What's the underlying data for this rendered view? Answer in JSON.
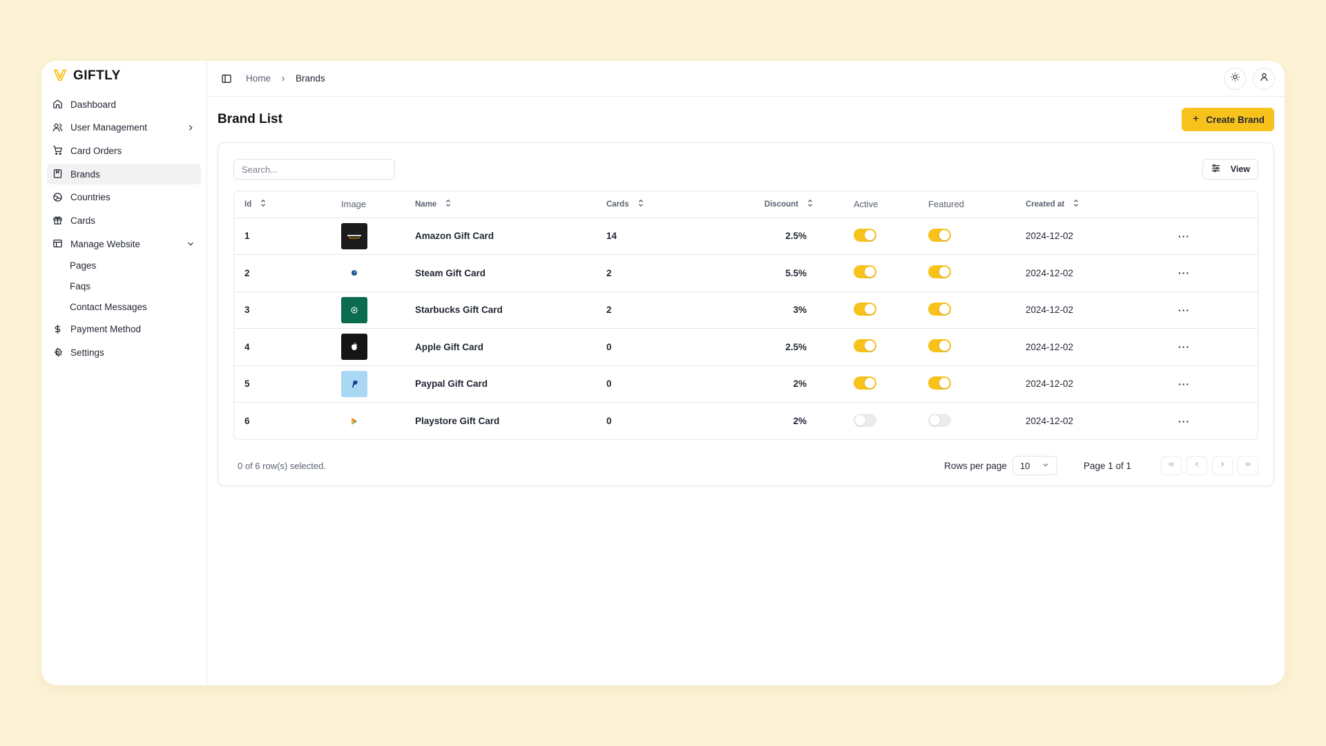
{
  "app": {
    "name": "GIFTLY",
    "accent": "#f8c21c",
    "background": "#fdf3d6"
  },
  "sidebar": {
    "items": [
      {
        "label": "Dashboard",
        "icon": "home-icon"
      },
      {
        "label": "User Management",
        "icon": "users-icon",
        "expandable": true,
        "expanded": false
      },
      {
        "label": "Card Orders",
        "icon": "cart-icon"
      },
      {
        "label": "Brands",
        "icon": "bookmark-icon",
        "active": true
      },
      {
        "label": "Countries",
        "icon": "globe-icon"
      },
      {
        "label": "Cards",
        "icon": "gift-icon"
      },
      {
        "label": "Manage Website",
        "icon": "layout-icon",
        "expandable": true,
        "expanded": true,
        "children": [
          "Pages",
          "Faqs",
          "Contact Messages"
        ]
      },
      {
        "label": "Payment Method",
        "icon": "dollar-icon"
      },
      {
        "label": "Settings",
        "icon": "settings-icon"
      }
    ]
  },
  "topbar": {
    "breadcrumb": {
      "home": "Home",
      "current": "Brands"
    },
    "icons": [
      "sun-icon",
      "user-icon"
    ]
  },
  "page": {
    "title": "Brand List",
    "create_label": "Create Brand"
  },
  "toolbar": {
    "search_placeholder": "Search...",
    "view_label": "View"
  },
  "table": {
    "columns": {
      "id": "Id",
      "image": "Image",
      "name": "Name",
      "cards": "Cards",
      "discount": "Discount",
      "active": "Active",
      "featured": "Featured",
      "created_at": "Created at"
    },
    "rows": [
      {
        "id": "1",
        "image": "amazon-logo",
        "thumb_bg": "#1b1b1b",
        "name": "Amazon Gift Card",
        "cards": "14",
        "discount": "2.5%",
        "active": true,
        "featured": true,
        "created_at": "2024-12-02"
      },
      {
        "id": "2",
        "image": "steam-logo",
        "thumb_bg": "#ffffff",
        "name": "Steam Gift Card",
        "cards": "2",
        "discount": "5.5%",
        "active": true,
        "featured": true,
        "created_at": "2024-12-02"
      },
      {
        "id": "3",
        "image": "starbucks-logo",
        "thumb_bg": "#0b6b4f",
        "name": "Starbucks Gift Card",
        "cards": "2",
        "discount": "3%",
        "active": true,
        "featured": true,
        "created_at": "2024-12-02"
      },
      {
        "id": "4",
        "image": "apple-logo",
        "thumb_bg": "#151515",
        "name": "Apple Gift Card",
        "cards": "0",
        "discount": "2.5%",
        "active": true,
        "featured": true,
        "created_at": "2024-12-02"
      },
      {
        "id": "5",
        "image": "paypal-logo",
        "thumb_bg": "#a9d8f5",
        "name": "Paypal Gift Card",
        "cards": "0",
        "discount": "2%",
        "active": true,
        "featured": true,
        "created_at": "2024-12-02"
      },
      {
        "id": "6",
        "image": "playstore-logo",
        "thumb_bg": "#ffffff",
        "name": "Playstore Gift Card",
        "cards": "0",
        "discount": "2%",
        "active": false,
        "featured": false,
        "created_at": "2024-12-02"
      }
    ]
  },
  "footer": {
    "selection_text": "0 of 6 row(s) selected.",
    "rows_per_page_label": "Rows per page",
    "rows_per_page_value": "10",
    "page_label": "Page 1 of 1"
  }
}
